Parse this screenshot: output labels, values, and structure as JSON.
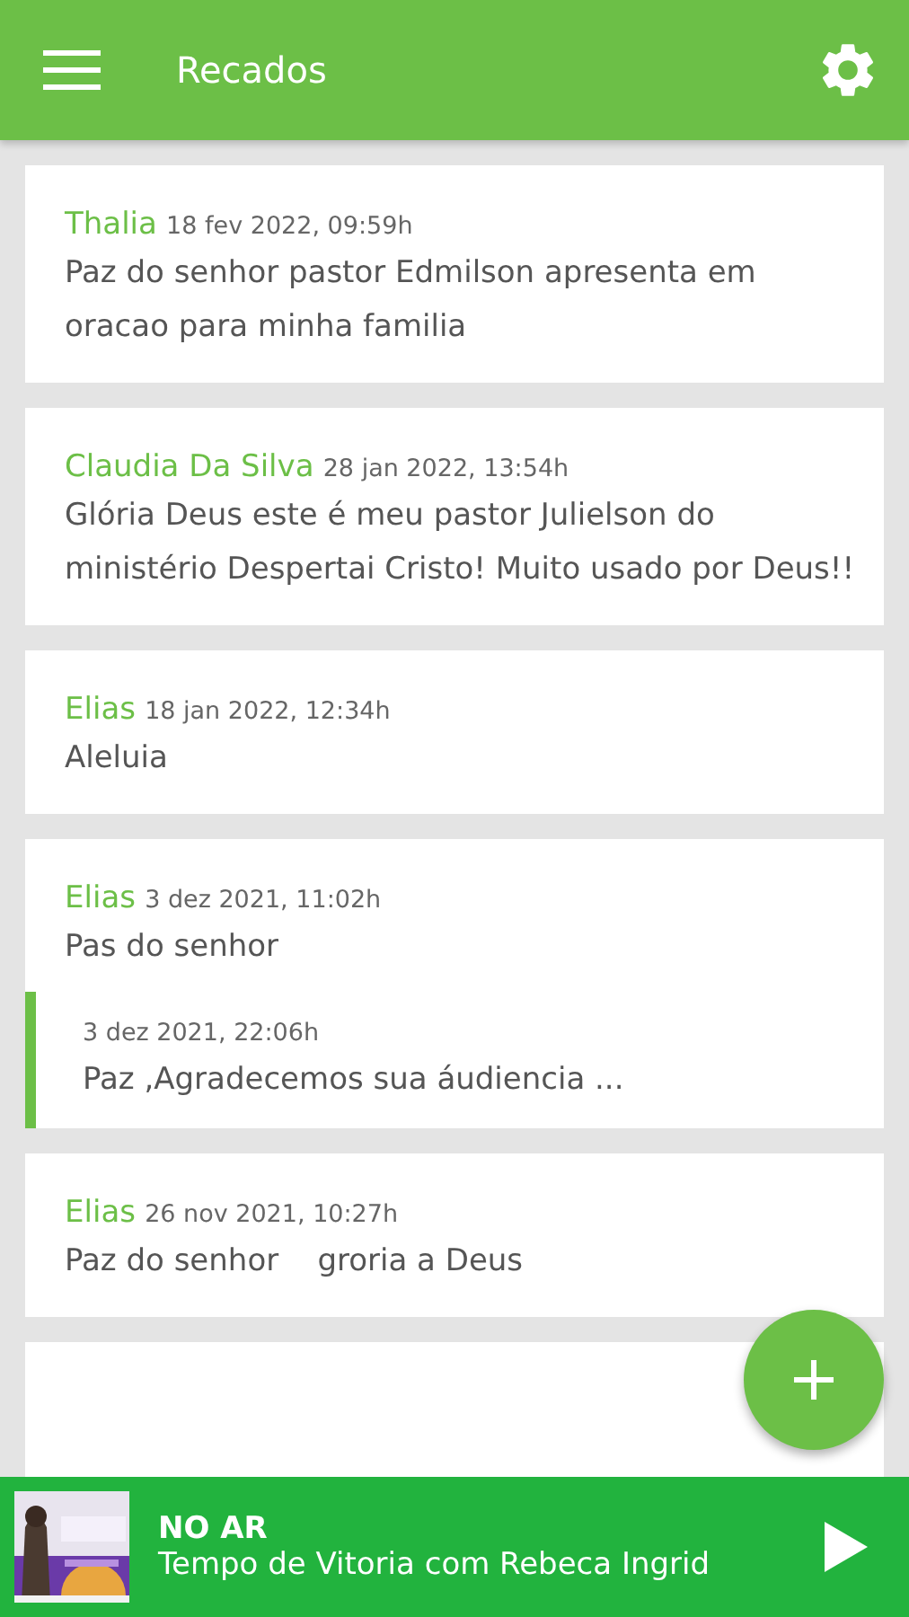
{
  "app_bar": {
    "title": "Recados"
  },
  "messages": [
    {
      "author": "Thalia",
      "date": "18 fev 2022, 09:59h",
      "text": "Paz do senhor pastor Edmilson apresenta em oracao para minha familia"
    },
    {
      "author": "Claudia Da Silva",
      "date": "28 jan 2022, 13:54h",
      "text": "Glória Deus este é meu pastor Julielson do ministério Despertai Cristo! Muito usado por Deus!!"
    },
    {
      "author": "Elias",
      "date": "18 jan 2022, 12:34h",
      "text": "Aleluia"
    },
    {
      "author": "Elias",
      "date": "3 dez 2021, 11:02h",
      "text": "Pas do senhor",
      "reply": {
        "date": "3 dez 2021, 22:06h",
        "text": "Paz ,Agradecemos sua áudiencia ..."
      }
    },
    {
      "author": "Elias",
      "date": "26 nov 2021, 10:27h",
      "text": "Paz do senhor    groria a Deus"
    }
  ],
  "player": {
    "status": "NO AR",
    "program": "Tempo de Vitoria com Rebeca Ingrid"
  }
}
